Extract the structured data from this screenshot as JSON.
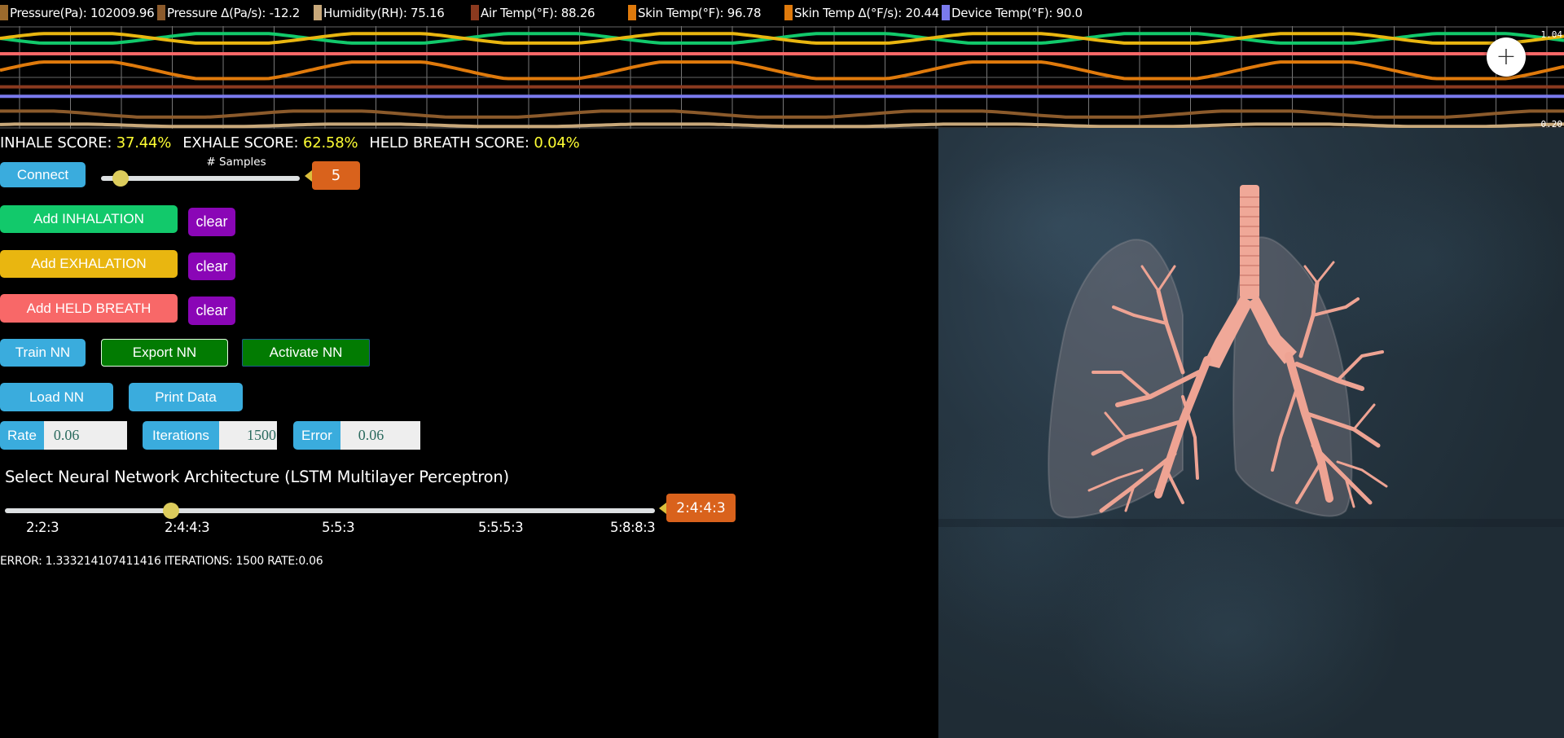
{
  "legend": [
    {
      "label": "Pressure(Pa): 102009.96",
      "color": "#9b6a2c"
    },
    {
      "label": "Pressure Δ(Pa/s): -12.2",
      "color": "#8b5a2b"
    },
    {
      "label": "Humidity(RH): 75.16",
      "color": "#c8a87a"
    },
    {
      "label": "Air Temp(°F): 88.26",
      "color": "#8b3a1f"
    },
    {
      "label": "Skin Temp(°F): 96.78",
      "color": "#df7a0c"
    },
    {
      "label": "Skin Temp Δ(°F/s): 20.44",
      "color": "#df7a0c"
    },
    {
      "label": "Device Temp(°F): 90.0",
      "color": "#7a7aee"
    }
  ],
  "chart": {
    "y_max_label": "1.04",
    "y_min_label": "0.20",
    "add_icon": "plus-icon"
  },
  "chart_data": {
    "type": "line",
    "title": "",
    "xlabel": "",
    "ylabel": "",
    "ylim": [
      0.2,
      1.04
    ],
    "grid": true,
    "series": [
      {
        "name": "inhale",
        "color": "#12c96b",
        "kind": "oscillating",
        "center": 0.95,
        "amplitude": 0.04,
        "phase": 3.14
      },
      {
        "name": "exhale",
        "color": "#e9b610",
        "kind": "oscillating",
        "center": 0.95,
        "amplitude": 0.04,
        "phase": 0
      },
      {
        "name": "held-breath",
        "color": "#f86868",
        "kind": "flat",
        "center": 0.82
      },
      {
        "name": "skin-temp",
        "color": "#df7a0c",
        "kind": "oscillating",
        "center": 0.68,
        "amplitude": 0.07,
        "phase": 0
      },
      {
        "name": "air-temp",
        "color": "#8b3a1f",
        "kind": "flat",
        "center": 0.54
      },
      {
        "name": "device-temp",
        "color": "#7a7aee",
        "kind": "flat",
        "center": 0.46
      },
      {
        "name": "pressure-delta",
        "color": "#8b5a2b",
        "kind": "oscillating",
        "center": 0.31,
        "amplitude": 0.025,
        "phase": 1.2
      },
      {
        "name": "humidity",
        "color": "#c8a87a",
        "kind": "oscillating",
        "center": 0.215,
        "amplitude": 0.01,
        "phase": 0.5
      }
    ]
  },
  "scores": {
    "inhale_label": "INHALE SCORE: ",
    "inhale_value": "37.44%",
    "exhale_label": "EXHALE SCORE: ",
    "exhale_value": "62.58%",
    "held_label": "HELD BREATH SCORE: ",
    "held_value": "0.04%"
  },
  "controls": {
    "connect": "Connect",
    "samples_label": "# Samples",
    "samples_value": "5",
    "samples_fraction": 0.1,
    "add_inhalation": "Add INHALATION",
    "add_exhalation": "Add EXHALATION",
    "add_held_breath": "Add HELD BREATH",
    "clear": "clear",
    "train_nn": "Train NN",
    "export_nn": "Export NN",
    "activate_nn": "Activate NN",
    "load_nn": "Load NN",
    "print_data": "Print Data",
    "rate_label": "Rate",
    "rate_value": "0.06",
    "iterations_label": "Iterations",
    "iterations_value": "1500",
    "error_label": "Error",
    "error_value": "0.06"
  },
  "architecture": {
    "title": "Select Neural Network Architecture (LSTM Multilayer Perceptron)",
    "options": [
      "2:2:3",
      "2:4:4:3",
      "5:5:3",
      "5:5:5:3",
      "5:8:8:3"
    ],
    "selected": "2:4:4:3",
    "selected_index": 1
  },
  "status_text": "ERROR: 1.333214107411416 ITERATIONS: 1500 RATE:0.06",
  "image": {
    "subject": "lungs-illustration"
  }
}
